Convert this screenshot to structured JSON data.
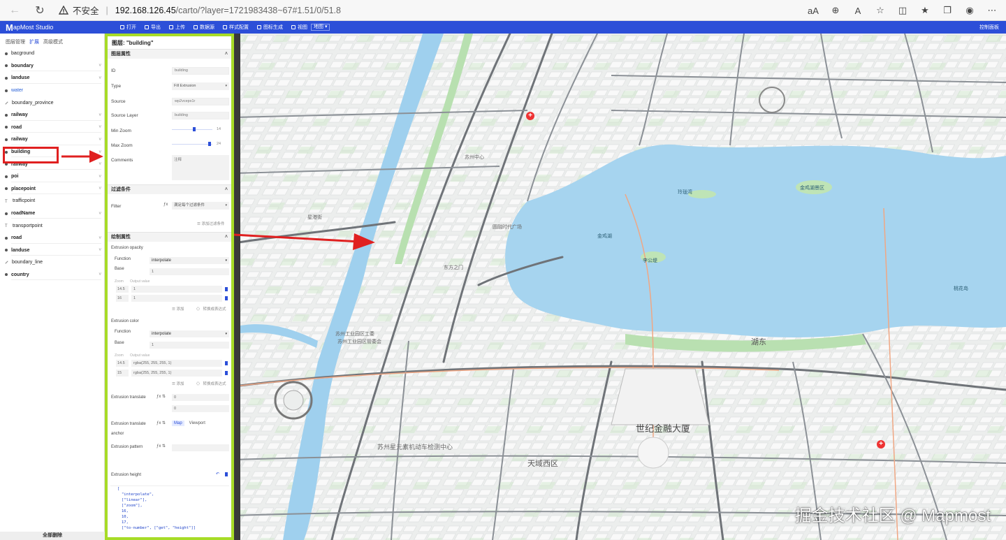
{
  "browser": {
    "insecure_label": "不安全",
    "url_host": "192.168.126.45",
    "url_path": "/carto/?layer=1721983438~67#1.51/0/51.8",
    "separator": "|"
  },
  "app": {
    "logo_mark": "M",
    "logo_text": "apMost Studio",
    "menu": [
      "打开",
      "导出",
      "上传",
      "数据源",
      "样式配置",
      "图标生成",
      "视图"
    ],
    "lang": "地图 ▾",
    "right_label": "控制面板"
  },
  "left_panel": {
    "tabs": [
      "图层管理",
      "扩展",
      "高级模式"
    ],
    "layers": [
      {
        "label": "bacground",
        "kind": "point",
        "group": false
      },
      {
        "label": "boundary",
        "kind": "point",
        "group": true
      },
      {
        "label": "landuse",
        "kind": "point",
        "group": true
      },
      {
        "label": "water",
        "kind": "point",
        "group": false,
        "color": "#2c63d8"
      },
      {
        "label": "boundary_province",
        "kind": "line",
        "group": false
      },
      {
        "label": "railway",
        "kind": "point",
        "group": true
      },
      {
        "label": "road",
        "kind": "point",
        "group": true
      },
      {
        "label": "railway",
        "kind": "point",
        "group": true
      },
      {
        "label": "building",
        "kind": "point",
        "group": true
      },
      {
        "label": "railway",
        "kind": "point",
        "group": true
      },
      {
        "label": "poi",
        "kind": "point",
        "group": true
      },
      {
        "label": "placepoint",
        "kind": "point",
        "group": true
      },
      {
        "label": "trafficpoint",
        "kind": "text",
        "group": false
      },
      {
        "label": "roadName",
        "kind": "point",
        "group": true
      },
      {
        "label": "transportpoint",
        "kind": "text",
        "group": false
      },
      {
        "label": "road",
        "kind": "point",
        "group": true
      },
      {
        "label": "landuse",
        "kind": "point",
        "group": true
      },
      {
        "label": "boundary_line",
        "kind": "line",
        "group": false
      },
      {
        "label": "country",
        "kind": "point",
        "group": true
      }
    ],
    "footer": "全部删除"
  },
  "props": {
    "title": "图层: \"building\"",
    "section_layer": "图层属性",
    "id_label": "ID",
    "id_value": "building",
    "type_label": "Type",
    "type_value": "Fill Extrusion",
    "source_label": "Source",
    "source_value": "wp2vcepx1r",
    "source_layer_label": "Source Layer",
    "source_layer_value": "building",
    "min_zoom_label": "Min Zoom",
    "min_zoom_value": "14",
    "max_zoom_label": "Max Zoom",
    "max_zoom_value": "24",
    "comments_label": "Comments",
    "comments_placeholder": "注释",
    "section_filter": "过滤条件",
    "filter_label": "Filter",
    "filter_value": "满足每个过滤条件",
    "filter_add": "添加过滤条件",
    "section_paint": "绘制属性",
    "opacity_label": "Extrusion opacity",
    "function_label": "Function",
    "function_value": "interpolate",
    "base_label": "Base",
    "base_value": "1",
    "zoom_hdr": "Zoom",
    "output_hdr": "Output value",
    "opacity_stops": [
      {
        "zoom": "14.5",
        "value": "1"
      },
      {
        "zoom": "16",
        "value": "1"
      }
    ],
    "add_stop": "添加",
    "to_expression": "转换成表达式",
    "color_label": "Extrusion color",
    "color_function_value": "interpolate",
    "color_base_value": "1",
    "color_stops": [
      {
        "zoom": "14.5",
        "value": "rgba(255, 255, 255, 1)"
      },
      {
        "zoom": "15",
        "value": "rgba(255, 255, 255, 1)"
      }
    ],
    "translate_label": "Extrusion translate",
    "translate_x": "0",
    "translate_y": "0",
    "anchor_label_1": "Extrusion translate",
    "anchor_label_2": "anchor",
    "anchor_map": "Map",
    "anchor_viewport": "Viewport",
    "pattern_label": "Extrusion pattern",
    "height_label": "Extrusion height",
    "height_code": [
      "[",
      "\"interpolate\",",
      "[\"linear\"],",
      "[\"zoom\"],",
      "16,",
      "10,",
      "17,",
      "[\"to-number\", [\"get\", \"height\"]]"
    ]
  },
  "map": {
    "labels": {
      "a": "苏州工业园区工委",
      "b": "苏州工业园区管委会",
      "c": "世纪金融大厦",
      "d": "天域西区",
      "e": "苏州星元素机动车检测中心",
      "f": "圆融时代广场",
      "g": "星港街",
      "h": "金鸡湖",
      "i": "李公堤",
      "j": "玲珑湾",
      "k": "苏州中心",
      "l": "东方之门",
      "m": "湖东",
      "n": "金鸡湖景区",
      "o": "桃花岛"
    },
    "watermark": "掘金技术社区 @ Mapmost"
  }
}
